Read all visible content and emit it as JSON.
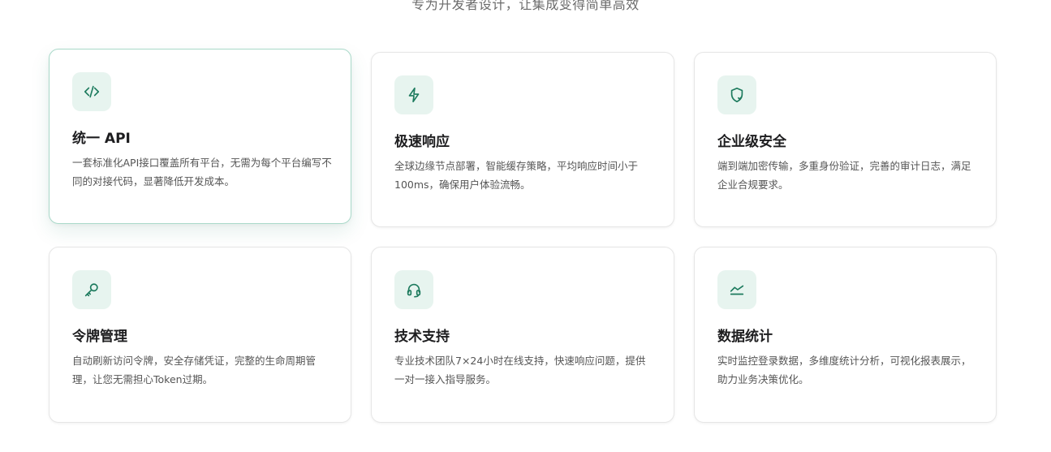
{
  "header": {
    "subtitle": "专为开发者设计，让集成变得简单高效"
  },
  "features": [
    {
      "icon": "code-icon",
      "title": "统一 API",
      "description": "一套标准化API接口覆盖所有平台，无需为每个平台编写不同的对接代码，显著降低开发成本。"
    },
    {
      "icon": "lightning-icon",
      "title": "极速响应",
      "description": "全球边缘节点部署，智能缓存策略，平均响应时间小于100ms，确保用户体验流畅。"
    },
    {
      "icon": "shield-icon",
      "title": "企业级安全",
      "description": "端到端加密传输，多重身份验证，完善的审计日志，满足企业合规要求。"
    },
    {
      "icon": "key-icon",
      "title": "令牌管理",
      "description": "自动刷新访问令牌，安全存储凭证，完整的生命周期管理，让您无需担心Token过期。"
    },
    {
      "icon": "headset-icon",
      "title": "技术支持",
      "description": "专业技术团队7×24小时在线支持，快速响应问题，提供一对一接入指导服务。"
    },
    {
      "icon": "chart-line-icon",
      "title": "数据统计",
      "description": "实时监控登录数据，多维度统计分析，可视化报表展示，助力业务决策优化。"
    }
  ],
  "colors": {
    "accent": "#1c7a5d",
    "icon_background": "#e7f4ef",
    "active_border": "#a9d9c9"
  }
}
